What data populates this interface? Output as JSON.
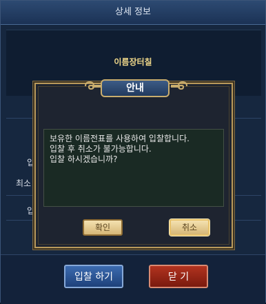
{
  "window": {
    "title": "상세 정보",
    "item_name": "이름장터칠",
    "side_labels": [
      "입",
      "최소",
      "입"
    ]
  },
  "footer": {
    "bid_button": "입찰 하기",
    "close_button": "닫 기"
  },
  "dialog": {
    "title": "안내",
    "message_lines": [
      "보유한 이름전표를 사용하여 입찰합니다.",
      "입찰 후 취소가 불가능합니다.",
      "입찰 하시겠습니까?"
    ],
    "ok_label": "확인",
    "cancel_label": "취소"
  },
  "colors": {
    "accent_gold": "#c9ad6e",
    "bid_button": "#3c6bb0",
    "close_button": "#b2331f"
  }
}
